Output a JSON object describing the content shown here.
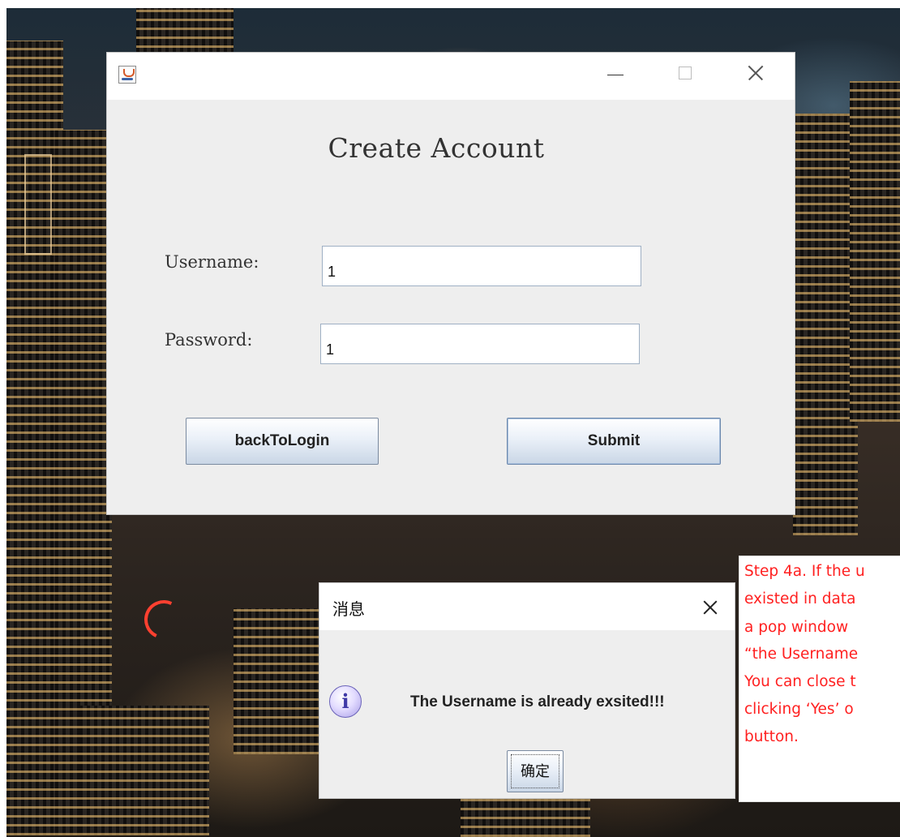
{
  "main_window": {
    "title": "Create Account",
    "fields": {
      "username_label": "Username:",
      "username_value": "1",
      "password_label": "Password:",
      "password_value": "1"
    },
    "buttons": {
      "back": "backToLogin",
      "submit": "Submit"
    }
  },
  "dialog": {
    "title": "消息",
    "message": "The Username is already exsited!!!",
    "ok_label": "确定",
    "icon": "info-icon"
  },
  "annotation": {
    "lines": [
      "Step 4a. If the u",
      "existed in data",
      "a pop window",
      "“the Username",
      "You can close t",
      "clicking ‘Yes’ o",
      "button."
    ],
    "color": "#ff2020"
  },
  "icons": {
    "app_icon": "java-cup-icon",
    "minimize": "minimize-icon",
    "maximize": "maximize-icon",
    "close": "close-icon"
  },
  "colors": {
    "window_bg": "#eeeeee",
    "titlebar_bg": "#ffffff",
    "field_border": "#9fb0c4",
    "button_border": "#7a8aa0"
  }
}
